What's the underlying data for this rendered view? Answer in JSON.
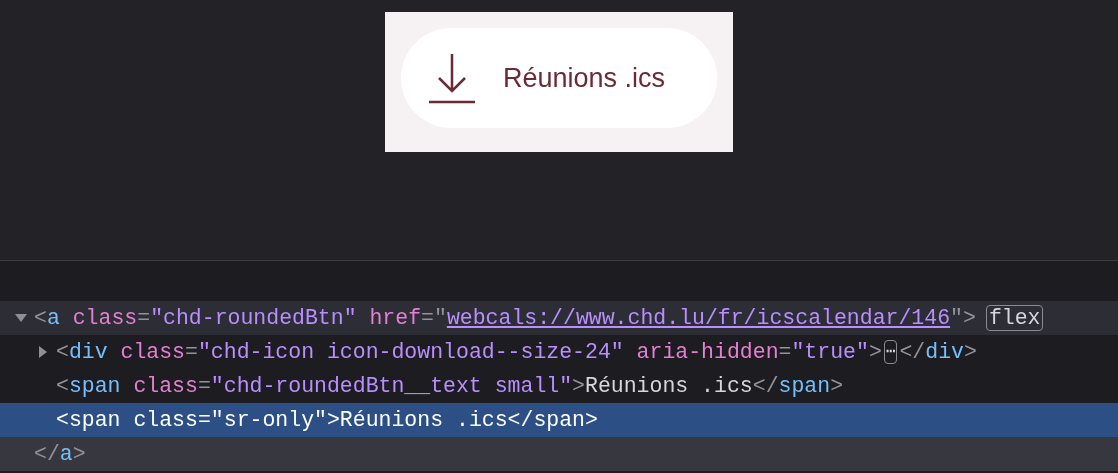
{
  "preview": {
    "button": {
      "label": "Réunions .ics"
    }
  },
  "inspector": {
    "nodes": [
      {
        "expanded": true,
        "selected": false,
        "highlighted": true,
        "tokens": [
          {
            "kind": "punct",
            "text": "<"
          },
          {
            "kind": "tag",
            "text": "a"
          },
          {
            "kind": "attr",
            "text": "class",
            "spaced": true
          },
          {
            "kind": "punct",
            "text": "="
          },
          {
            "kind": "value",
            "text": "\"chd-roundedBtn\""
          },
          {
            "kind": "attr",
            "text": "href",
            "spaced": true
          },
          {
            "kind": "punct",
            "text": "=\""
          },
          {
            "kind": "link",
            "text": "webcals://www.chd.lu/fr/icscalendar/146"
          },
          {
            "kind": "punct",
            "text": "\">"
          },
          {
            "kind": "badge",
            "text": "flex"
          }
        ],
        "children": [
          {
            "expanded": false,
            "selected": false,
            "tokens": [
              {
                "kind": "punct",
                "text": "<"
              },
              {
                "kind": "tag",
                "text": "div"
              },
              {
                "kind": "attr",
                "text": "class",
                "spaced": true
              },
              {
                "kind": "punct",
                "text": "="
              },
              {
                "kind": "value",
                "text": "\"chd-icon icon-download--size-24\""
              },
              {
                "kind": "attr",
                "text": "aria-hidden",
                "spaced": true
              },
              {
                "kind": "punct",
                "text": "="
              },
              {
                "kind": "value",
                "text": "\"true\""
              },
              {
                "kind": "punct",
                "text": ">"
              },
              {
                "kind": "more",
                "text": "⋯"
              },
              {
                "kind": "punct",
                "text": "</"
              },
              {
                "kind": "tag",
                "text": "div"
              },
              {
                "kind": "punct",
                "text": ">"
              }
            ]
          },
          {
            "selected": false,
            "tokens": [
              {
                "kind": "punct",
                "text": "<"
              },
              {
                "kind": "tag",
                "text": "span"
              },
              {
                "kind": "attr",
                "text": "class",
                "spaced": true
              },
              {
                "kind": "punct",
                "text": "="
              },
              {
                "kind": "value",
                "text": "\"chd-roundedBtn__text small\""
              },
              {
                "kind": "punct",
                "text": ">"
              },
              {
                "kind": "text",
                "text": "Réunions .ics"
              },
              {
                "kind": "punct",
                "text": "</"
              },
              {
                "kind": "tag",
                "text": "span"
              },
              {
                "kind": "punct",
                "text": ">"
              }
            ]
          },
          {
            "selected": true,
            "tokens": [
              {
                "kind": "punct",
                "text": "<"
              },
              {
                "kind": "tag",
                "text": "span"
              },
              {
                "kind": "attr",
                "text": "class",
                "spaced": true
              },
              {
                "kind": "punct",
                "text": "="
              },
              {
                "kind": "value",
                "text": "\"sr-only\""
              },
              {
                "kind": "punct",
                "text": ">"
              },
              {
                "kind": "text",
                "text": "Réunions .ics"
              },
              {
                "kind": "punct",
                "text": "</"
              },
              {
                "kind": "tag",
                "text": "span"
              },
              {
                "kind": "punct",
                "text": ">"
              }
            ]
          }
        ],
        "closing_tokens": [
          {
            "kind": "punct",
            "text": "</"
          },
          {
            "kind": "tag",
            "text": "a"
          },
          {
            "kind": "punct",
            "text": ">"
          }
        ]
      }
    ]
  }
}
